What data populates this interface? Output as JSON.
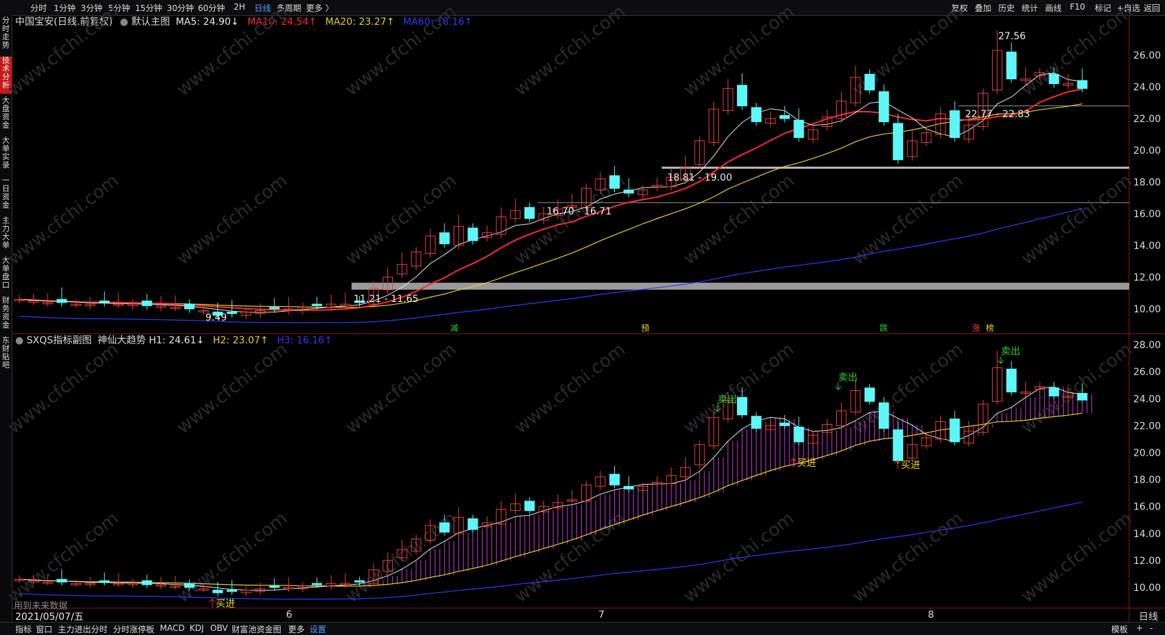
{
  "toolbar": {
    "period_tabs": [
      "分时",
      "1分钟",
      "3分钟",
      "5分钟",
      "15分钟",
      "30分钟",
      "60分钟",
      "2H",
      "日线",
      "多周期",
      "更多 〉"
    ],
    "active_period": "日线",
    "right_tools": [
      "复权",
      "叠加",
      "历史",
      "统计",
      "画线",
      "F10",
      "标记",
      "+自选",
      "返回"
    ]
  },
  "left_tabs": [
    "分时走势",
    "技术分析",
    "大盘资金",
    "大单实录",
    "一日资金",
    "主力大单",
    "大单盘口",
    "财务资金",
    "东财贴吧"
  ],
  "main_chart": {
    "title": "中国宝安(日线.前复权)",
    "template": "默认主图",
    "ma": [
      {
        "label": "MA5: 24.90↓",
        "color": "#e8e8e8"
      },
      {
        "label": "MA10: 24.54↑",
        "color": "#ff2a2a"
      },
      {
        "label": "MA20: 23.27↑",
        "color": "#e6d31f"
      },
      {
        "label": "MA60: 18.16↑",
        "color": "#2b3cff"
      }
    ],
    "y_ticks": [
      "26.00",
      "24.00",
      "22.00",
      "20.00",
      "18.00",
      "16.00",
      "14.00",
      "12.00",
      "10.00"
    ],
    "y_values": [
      26,
      24,
      22,
      20,
      18,
      16,
      14,
      12,
      10
    ],
    "annotations": [
      {
        "text": "27.56"
      },
      {
        "text": "9.49"
      },
      {
        "text": "22.77 - 22.83"
      },
      {
        "text": "18.81 - 19.00"
      },
      {
        "text": "16.70 - 16.71"
      },
      {
        "text": "11.21 - 11.65"
      }
    ],
    "event_marks": [
      "减",
      "预",
      "跌",
      "涨",
      "榜"
    ]
  },
  "sub_chart": {
    "title": "SXQS指标副图",
    "indicator": "神仙大趋势",
    "lines": [
      {
        "label": "H1: 24.61↓",
        "color": "#e8e8e8"
      },
      {
        "label": "H2: 23.07↑",
        "color": "#e6d31f"
      },
      {
        "label": "H3: 16.16↑",
        "color": "#2b3cff"
      }
    ],
    "y_ticks": [
      "28.00",
      "26.00",
      "24.00",
      "22.00",
      "20.00",
      "18.00",
      "16.00",
      "14.00",
      "12.00",
      "10.00"
    ],
    "y_values": [
      28,
      26,
      24,
      22,
      20,
      18,
      16,
      14,
      12,
      10
    ],
    "signals_sell": [
      "卖出",
      "卖出",
      "卖出"
    ],
    "signals_buy": [
      "买进",
      "买进",
      "买进"
    ],
    "footnote": "用到未来数据"
  },
  "x_axis": {
    "date_label": "2021/05/07/五",
    "months": [
      "6",
      "7",
      "8"
    ],
    "period_label": "日线"
  },
  "bottom_tabs": [
    "指标",
    "窗口",
    "主力进出分时",
    "分时涨停板",
    "MACD",
    "KDJ",
    "OBV",
    "财富池资金图",
    "更多",
    "设置"
  ],
  "bottom_right": [
    "模板",
    "+",
    "-"
  ],
  "watermark": "www.cfchi.com",
  "colors": {
    "up": "#e8413a",
    "down": "#5ef7f7",
    "ma5": "#e8e8e8",
    "ma10": "#ff2a2a",
    "ma20": "#e6d31f",
    "ma60": "#2b3cff",
    "fill": "#c93cd6"
  }
}
